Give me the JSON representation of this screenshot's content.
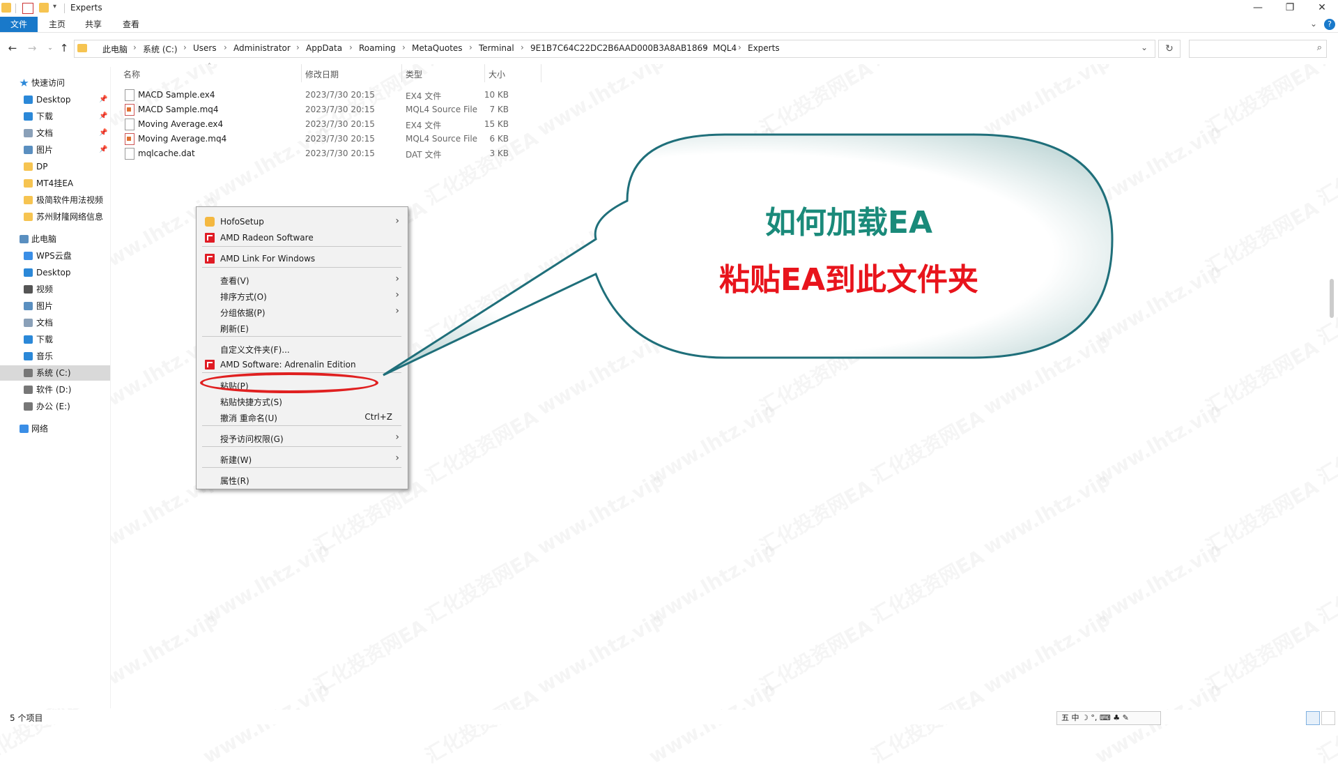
{
  "window": {
    "title": "Experts",
    "controls": {
      "minimize": "—",
      "maximize": "❐",
      "close": "✕"
    }
  },
  "ribbon": {
    "tabs": [
      "文件",
      "主页",
      "共享",
      "查看"
    ],
    "help_icon": "?",
    "expand_icon": "⌄"
  },
  "address": {
    "crumbs": [
      "此电脑",
      "系统 (C:)",
      "Users",
      "Administrator",
      "AppData",
      "Roaming",
      "MetaQuotes",
      "Terminal",
      "9E1B7C64C22DC2B6AAD000B3A8AB1869",
      "MQL4",
      "Experts"
    ],
    "separator": "›",
    "refresh_icon": "↻",
    "search_placeholder": ""
  },
  "nav": {
    "quick_access": "快速访问",
    "items": [
      {
        "label": "Desktop",
        "icon": "desktop-icon",
        "pinned": true
      },
      {
        "label": "下载",
        "icon": "download-icon",
        "pinned": true
      },
      {
        "label": "文档",
        "icon": "document-icon",
        "pinned": true
      },
      {
        "label": "图片",
        "icon": "picture-icon",
        "pinned": true
      },
      {
        "label": "DP",
        "icon": "folder-icon",
        "pinned": false
      },
      {
        "label": "MT4挂EA",
        "icon": "folder-icon",
        "pinned": false
      },
      {
        "label": "极简软件用法视频",
        "icon": "folder-icon",
        "pinned": false
      },
      {
        "label": "苏州财隆网络信息",
        "icon": "folder-icon",
        "pinned": false
      }
    ],
    "this_pc": "此电脑",
    "pc_items": [
      {
        "label": "WPS云盘",
        "icon": "cloud-icon"
      },
      {
        "label": "Desktop",
        "icon": "desktop-icon"
      },
      {
        "label": "视频",
        "icon": "video-icon"
      },
      {
        "label": "图片",
        "icon": "picture-icon"
      },
      {
        "label": "文档",
        "icon": "document-icon"
      },
      {
        "label": "下载",
        "icon": "download-icon"
      },
      {
        "label": "音乐",
        "icon": "music-icon"
      },
      {
        "label": "系统 (C:)",
        "icon": "drive-icon",
        "selected": true
      },
      {
        "label": "软件 (D:)",
        "icon": "drive-icon"
      },
      {
        "label": "办公 (E:)",
        "icon": "drive-icon"
      }
    ],
    "network": "网络"
  },
  "columns": {
    "name": "名称",
    "modified": "修改日期",
    "type": "类型",
    "size": "大小"
  },
  "files": [
    {
      "name": "MACD Sample.ex4",
      "modified": "2023/7/30 20:15",
      "type": "EX4 文件",
      "size": "10 KB",
      "icon": "ex4-file-icon"
    },
    {
      "name": "MACD Sample.mq4",
      "modified": "2023/7/30 20:15",
      "type": "MQL4 Source File",
      "size": "7 KB",
      "icon": "mq4-file-icon"
    },
    {
      "name": "Moving Average.ex4",
      "modified": "2023/7/30 20:15",
      "type": "EX4 文件",
      "size": "15 KB",
      "icon": "ex4-file-icon"
    },
    {
      "name": "Moving Average.mq4",
      "modified": "2023/7/30 20:15",
      "type": "MQL4 Source File",
      "size": "6 KB",
      "icon": "mq4-file-icon"
    },
    {
      "name": "mqlcache.dat",
      "modified": "2023/7/30 20:15",
      "type": "DAT 文件",
      "size": "3 KB",
      "icon": "dat-file-icon"
    }
  ],
  "context_menu": {
    "items": [
      {
        "label": "HofoSetup",
        "submenu": true
      },
      {
        "label": "AMD Radeon Software"
      },
      {
        "label": "AMD Link For Windows"
      },
      {
        "label": "查看(V)",
        "submenu": true
      },
      {
        "label": "排序方式(O)",
        "submenu": true
      },
      {
        "label": "分组依据(P)",
        "submenu": true
      },
      {
        "label": "刷新(E)"
      },
      {
        "label": "自定义文件夹(F)..."
      },
      {
        "label": "AMD Software: Adrenalin Edition"
      },
      {
        "label": "粘贴(P)"
      },
      {
        "label": "粘贴快捷方式(S)"
      },
      {
        "label": "撤消 重命名(U)",
        "shortcut": "Ctrl+Z"
      },
      {
        "label": "授予访问权限(G)",
        "submenu": true
      },
      {
        "label": "新建(W)",
        "submenu": true
      },
      {
        "label": "属性(R)"
      }
    ]
  },
  "callout": {
    "title": "如何加载EA",
    "subtitle": "粘贴EA到此文件夹",
    "title_color": "#1a8a7a",
    "subtitle_color": "#e8141c"
  },
  "watermark": {
    "text1": "汇化投资网EA",
    "text2": "www.lhtz.vip"
  },
  "status": {
    "item_count": "5 个项目",
    "ime": "五 中 ☽ °, ⌨ ♣ ✎"
  }
}
